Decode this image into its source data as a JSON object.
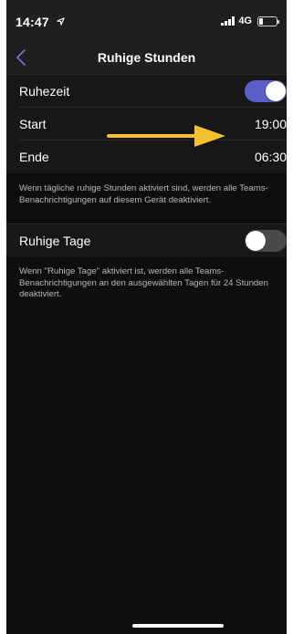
{
  "status_bar": {
    "time": "14:47",
    "network": "4G",
    "location_icon": "location-arrow-icon",
    "signal_icon": "cellular-signal-icon",
    "battery_icon": "battery-icon",
    "battery_level": 0.25
  },
  "nav": {
    "title": "Ruhige Stunden",
    "back_icon": "chevron-left-icon",
    "accent_color": "#5b5fc7"
  },
  "quiet_hours": {
    "toggle_label": "Ruhezeit",
    "enabled": true,
    "start_label": "Start",
    "start_value": "19:00",
    "end_label": "Ende",
    "end_value": "06:30",
    "description": "Wenn tägliche ruhige Stunden aktiviert sind, werden alle Teams-Benachrichtigungen auf diesem Gerät deaktiviert."
  },
  "quiet_days": {
    "toggle_label": "Ruhige Tage",
    "enabled": false,
    "description": "Wenn \"Ruhige Tage\" aktiviert ist, werden alle Teams-Benachrichtigungen an den ausgewählten Tagen für 24 Stunden deaktiviert."
  },
  "annotation": {
    "arrow_color": "#f7c12e"
  }
}
